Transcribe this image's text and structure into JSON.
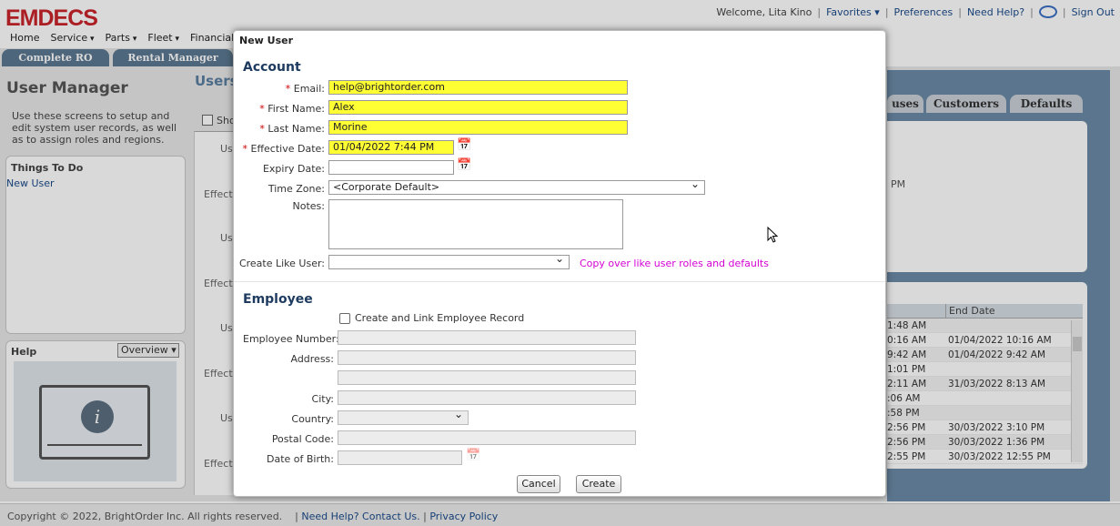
{
  "header": {
    "logo_text": "EMDECS",
    "welcome": "Welcome, Lita Kino",
    "favorites": "Favorites",
    "preferences": "Preferences",
    "need_help": "Need Help?",
    "sign_out": "Sign Out",
    "separator": "|"
  },
  "menu": [
    "Home",
    "Service",
    "Parts",
    "Fleet",
    "Financials"
  ],
  "tabs": [
    "Complete RO",
    "Rental Manager"
  ],
  "left": {
    "title": "User Manager",
    "description": "Use these screens to setup and edit system user records, as well as to assign roles and regions.",
    "things_title": "Things To Do",
    "things_link": "New User",
    "help_title": "Help",
    "help_select": "Overview"
  },
  "middle": {
    "heading": "Users",
    "show_label": "Sho",
    "row_labels": [
      "Us",
      "Effecti",
      "Us",
      "Effecti",
      "Us",
      "Effecti",
      "Us",
      "Effecti"
    ]
  },
  "right": {
    "tabs": [
      "uses",
      "Customers",
      "Defaults"
    ],
    "panel_text": "PM",
    "grid_header": [
      "",
      "End Date"
    ],
    "grid_rows": [
      [
        "1:48 AM",
        ""
      ],
      [
        "0:16 AM",
        "01/04/2022 10:16 AM"
      ],
      [
        "9:42 AM",
        "01/04/2022 9:42 AM"
      ],
      [
        "1:01 PM",
        ""
      ],
      [
        "2:11 AM",
        "31/03/2022 8:13 AM"
      ],
      [
        ":06 AM",
        ""
      ],
      [
        ":58 PM",
        ""
      ],
      [
        "2:56 PM",
        "30/03/2022 3:10 PM"
      ],
      [
        "2:56 PM",
        "30/03/2022 1:36 PM"
      ],
      [
        "2:55 PM",
        "30/03/2022 12:55 PM"
      ]
    ]
  },
  "dialog": {
    "title": "New User",
    "account_heading": "Account",
    "email_label": "Email:",
    "email_value": "help@brightorder.com",
    "first_name_label": "First Name:",
    "first_name_value": "Alex",
    "last_name_label": "Last Name:",
    "last_name_value": "Morine",
    "effective_date_label": "Effective Date:",
    "effective_date_value": "01/04/2022 7:44 PM",
    "expiry_date_label": "Expiry Date:",
    "expiry_date_value": "",
    "time_zone_label": "Time Zone:",
    "time_zone_value": "<Corporate Default>",
    "notes_label": "Notes:",
    "notes_value": "",
    "create_like_label": "Create Like User:",
    "create_like_value": "",
    "copy_over_text": "Copy over like user roles and defaults",
    "employee_heading": "Employee",
    "create_link_label": "Create and Link Employee Record",
    "employee_number_label": "Employee Number:",
    "address_label": "Address:",
    "city_label": "City:",
    "country_label": "Country:",
    "postal_code_label": "Postal Code:",
    "dob_label": "Date of Birth:",
    "required_mark": "*",
    "cancel": "Cancel",
    "create": "Create"
  },
  "footer": {
    "copyright": "Copyright © 2022, BrightOrder Inc. All rights reserved.",
    "contact": "Need Help? Contact Us.",
    "privacy": "Privacy Policy",
    "separator": "|"
  },
  "colors": {
    "brand_red": "#c8242b",
    "tab_blue": "#5c7891",
    "required_yellow": "#ffff33",
    "link_magenta": "#d400d4"
  }
}
